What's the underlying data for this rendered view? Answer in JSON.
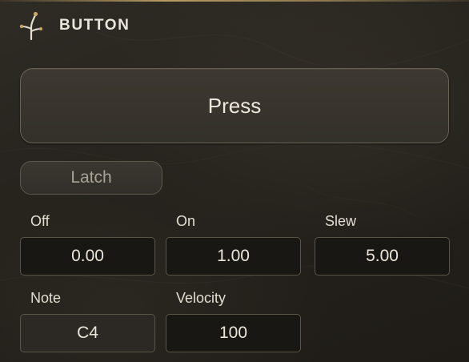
{
  "header": {
    "title": "BUTTON",
    "logo_icon": "branch-logo-icon"
  },
  "main": {
    "press_label": "Press",
    "latch_label": "Latch"
  },
  "params": {
    "off": {
      "label": "Off",
      "value": "0.00"
    },
    "on": {
      "label": "On",
      "value": "1.00"
    },
    "slew": {
      "label": "Slew",
      "value": "5.00"
    },
    "note": {
      "label": "Note",
      "value": "C4"
    },
    "velocity": {
      "label": "Velocity",
      "value": "100"
    }
  },
  "colors": {
    "accent": "#b89a62",
    "background": "#27231e",
    "field_bg": "#191714",
    "border": "#6a6355"
  }
}
